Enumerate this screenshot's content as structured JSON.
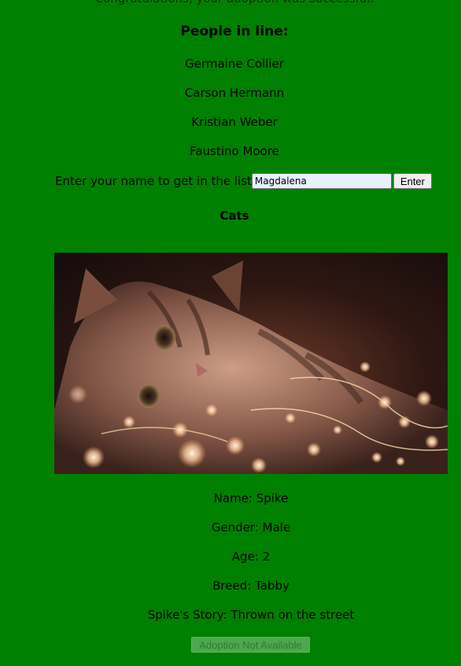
{
  "adoption": {
    "success_message": "Congratulations, your adoption was successful."
  },
  "queue": {
    "title": "People in line:",
    "people": [
      "Germaine Collier",
      "Carson Hermann",
      "Kristian Weber",
      "Faustino Moore"
    ]
  },
  "join": {
    "label": "Enter your name to get in the list",
    "name_value": "Magdalena",
    "enter_label": "Enter"
  },
  "pets": {
    "section_title": "Cats",
    "photo_alt": "Cat lying among string lights",
    "name_line": "Name: Spike",
    "gender_line": "Gender: Male",
    "age_line": "Age: 2",
    "breed_line": "Breed: Tabby",
    "story_line": "Spike's Story: Thrown on the street",
    "adopt_label": "Adoption Not Available"
  },
  "colors": {
    "background": "#008000",
    "input_background": "#e8f0fe",
    "disabled_button": "#4ea84e"
  }
}
